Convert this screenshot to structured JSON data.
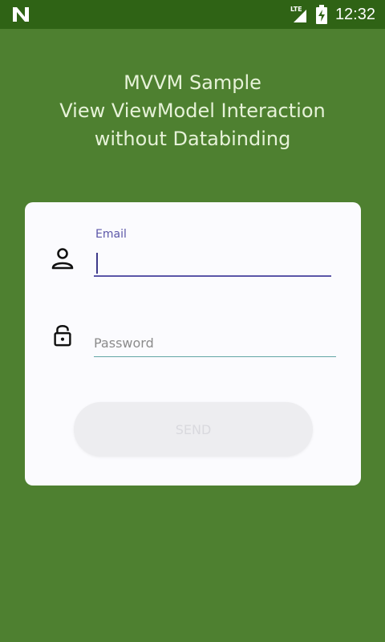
{
  "status_bar": {
    "network_label": "LTE",
    "time": "12:32",
    "icons": [
      "notification-n-icon",
      "signal-icon",
      "battery-charging-icon"
    ]
  },
  "header": {
    "title_lines": [
      "MVVM Sample",
      "View ViewModel Interaction",
      "without Databinding"
    ]
  },
  "form": {
    "email": {
      "label": "Email",
      "value": "",
      "icon": "person-icon"
    },
    "password": {
      "placeholder": "Password",
      "value": "",
      "icon": "lock-icon"
    },
    "submit": {
      "label": "SEND",
      "enabled": false
    }
  },
  "colors": {
    "background": "#4e8030",
    "status_bar": "#2f6315",
    "card": "#fbfbfe",
    "accent": "#5b56a8"
  }
}
